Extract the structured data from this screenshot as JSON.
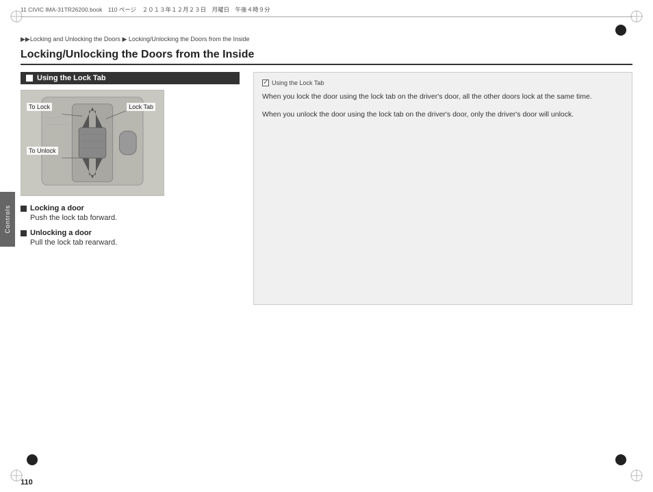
{
  "print_header": {
    "text": "11 CIVIC IMA-31TR26200.book　110 ページ　２０１３年１２月２３日　月曜日　午後４時９分"
  },
  "breadcrumb": {
    "part1": "▶▶Locking and Unlocking the Doors",
    "arrow": "▶",
    "part2": "Locking/Unlocking the Doors from the Inside"
  },
  "page_title": "Locking/Unlocking the Doors from the Inside",
  "section_label": "Using the Lock Tab",
  "diagram": {
    "to_lock_label": "To Lock",
    "lock_tab_label": "Lock Tab",
    "to_unlock_label": "To Unlock"
  },
  "locking": {
    "title": "Locking a door",
    "text": "Push the lock tab forward."
  },
  "unlocking": {
    "title": "Unlocking a door",
    "text": "Pull the lock tab rearward."
  },
  "right_col": {
    "note_title": "Using the Lock Tab",
    "note1": "When you lock the door using the lock tab on the driver's door, all the other doors lock at the same time.",
    "note2": "When you unlock the door using the lock tab on the driver's door, only the driver's door will unlock."
  },
  "page_number": "110",
  "controls_label": "Controls"
}
